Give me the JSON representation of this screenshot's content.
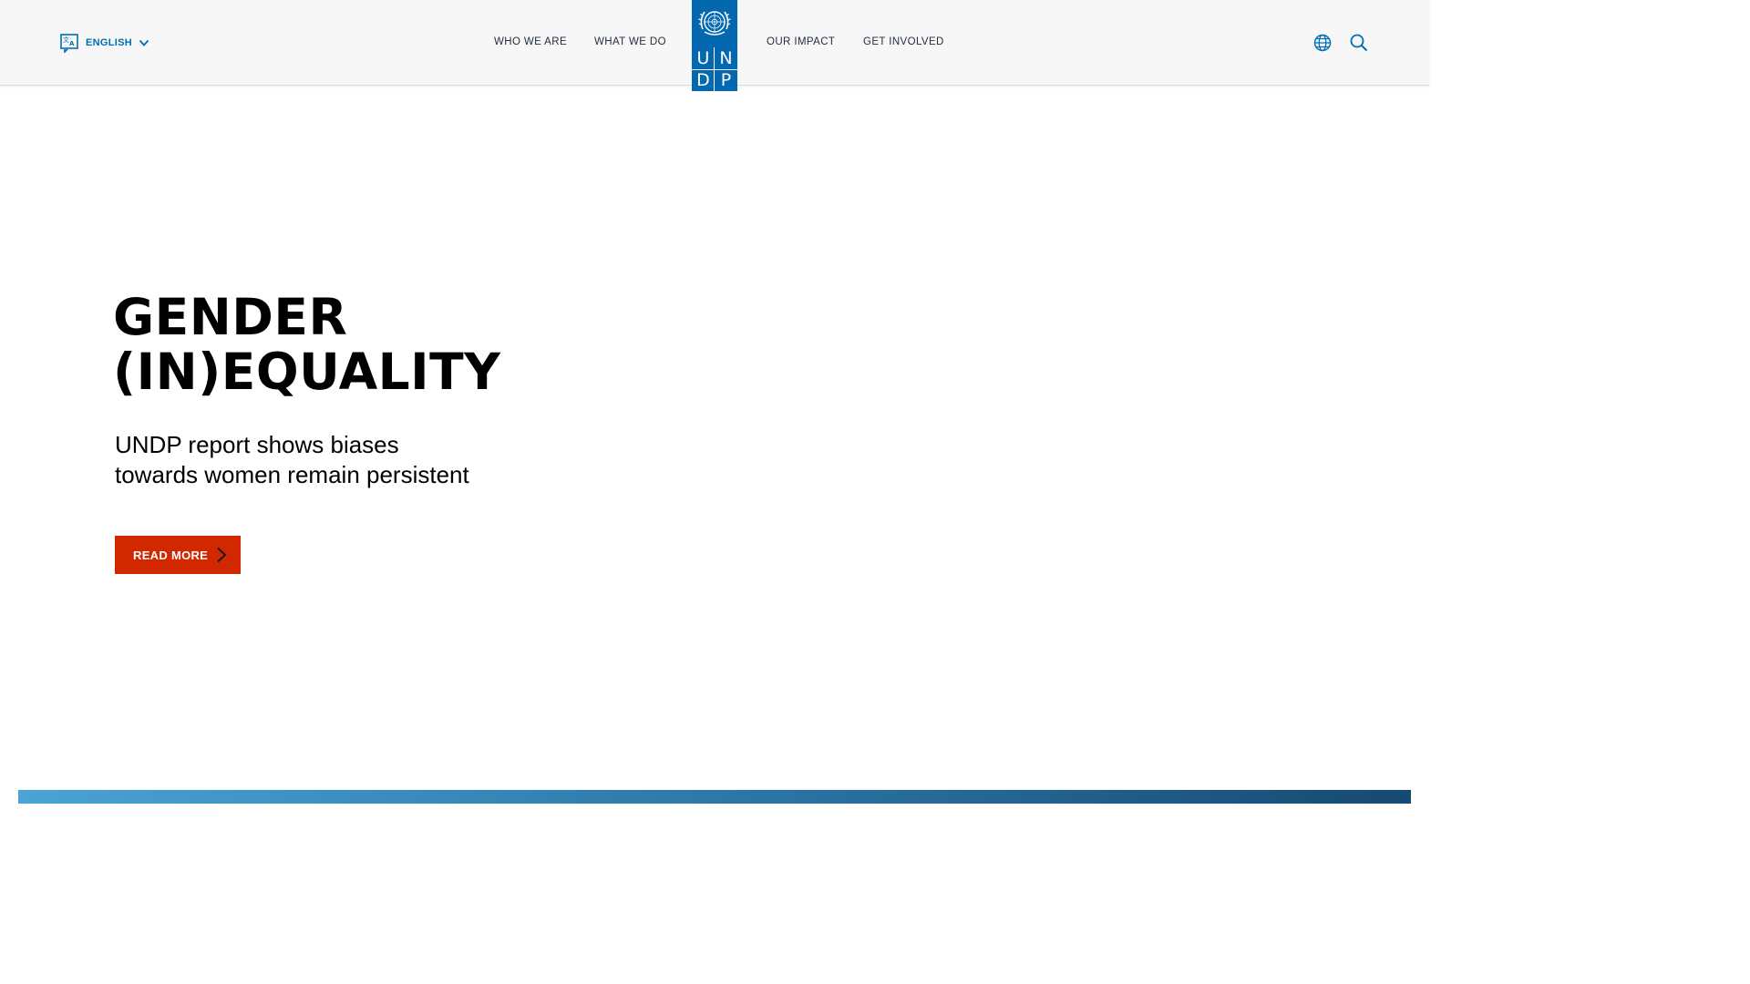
{
  "header": {
    "language": {
      "label": "ENGLISH",
      "icon": "translate-icon"
    },
    "nav": [
      {
        "label": "WHO WE ARE"
      },
      {
        "label": "WHAT WE DO"
      },
      {
        "label": "OUR IMPACT"
      },
      {
        "label": "GET INVOLVED"
      }
    ],
    "logo": {
      "letters": [
        "U",
        "N",
        "D",
        "P"
      ],
      "color": "#0468b1"
    },
    "icons": [
      "globe-icon",
      "search-icon"
    ]
  },
  "hero": {
    "title_lines": [
      "GENDER",
      "(IN)EQUALITY"
    ],
    "subtitle_lines": [
      "UNDP report shows biases",
      "towards women remain persistent"
    ],
    "cta_label": "READ MORE",
    "cta_color": "#d12800"
  },
  "colors": {
    "brand_blue": "#0468b1",
    "link_blue": "#006eb5",
    "header_bg": "#f7f7f7"
  }
}
